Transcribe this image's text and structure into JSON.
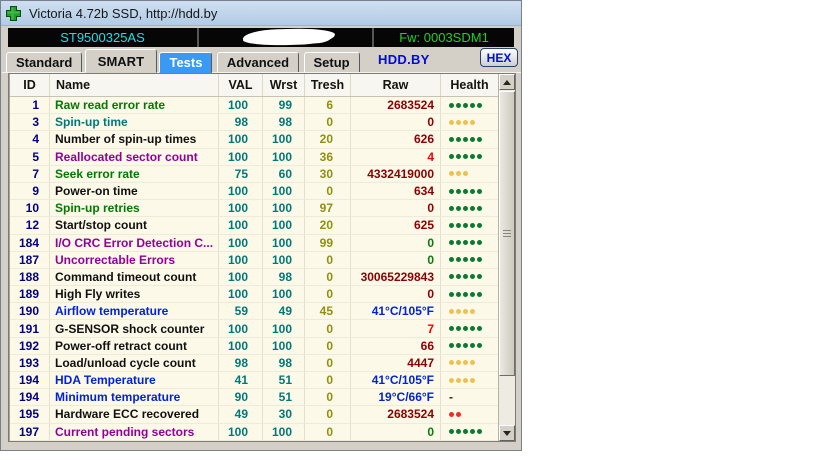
{
  "window": {
    "title": "Victoria 4.72b SSD, http://hdd.by",
    "icon": "green-cross-icon"
  },
  "drive_bar": {
    "model": "ST9500325AS",
    "serial": "(redacted)",
    "firmware": "Fw: 0003SDM1"
  },
  "tab_bar": {
    "tabs": [
      {
        "label": "Standard"
      },
      {
        "label": "SMART"
      },
      {
        "label": "Tests"
      },
      {
        "label": "Advanced"
      },
      {
        "label": "Setup"
      }
    ],
    "active_tab": "SMART",
    "highlighted_tab": "Tests",
    "brand": "HDD.BY",
    "hex_button": "HEX"
  },
  "smart_table": {
    "columns": [
      "ID",
      "Name",
      "VAL",
      "Wrst",
      "Tresh",
      "Raw",
      "Health"
    ],
    "rows": [
      {
        "id": "1",
        "name": "Raw read error rate",
        "name_color": "green",
        "val": "100",
        "wrst": "99",
        "tresh": "6",
        "raw": "2683524",
        "raw_color": "maroon",
        "health_dots": 5,
        "health_color": "green"
      },
      {
        "id": "3",
        "name": "Spin-up time",
        "name_color": "teal",
        "val": "98",
        "wrst": "98",
        "tresh": "0",
        "raw": "0",
        "raw_color": "maroon",
        "health_dots": 4,
        "health_color": "yellow"
      },
      {
        "id": "4",
        "name": "Number of spin-up times",
        "name_color": "black",
        "val": "100",
        "wrst": "100",
        "tresh": "20",
        "raw": "626",
        "raw_color": "maroon",
        "health_dots": 5,
        "health_color": "green"
      },
      {
        "id": "5",
        "name": "Reallocated sector count",
        "name_color": "purple",
        "val": "100",
        "wrst": "100",
        "tresh": "36",
        "raw": "4",
        "raw_color": "red",
        "health_dots": 5,
        "health_color": "green"
      },
      {
        "id": "7",
        "name": "Seek error rate",
        "name_color": "green",
        "val": "75",
        "wrst": "60",
        "tresh": "30",
        "raw": "4332419000",
        "raw_color": "maroon",
        "health_dots": 3,
        "health_color": "yellow"
      },
      {
        "id": "9",
        "name": "Power-on time",
        "name_color": "black",
        "val": "100",
        "wrst": "100",
        "tresh": "0",
        "raw": "634",
        "raw_color": "maroon",
        "health_dots": 5,
        "health_color": "green"
      },
      {
        "id": "10",
        "name": "Spin-up retries",
        "name_color": "green",
        "val": "100",
        "wrst": "100",
        "tresh": "97",
        "raw": "0",
        "raw_color": "maroon",
        "health_dots": 5,
        "health_color": "green"
      },
      {
        "id": "12",
        "name": "Start/stop count",
        "name_color": "black",
        "val": "100",
        "wrst": "100",
        "tresh": "20",
        "raw": "625",
        "raw_color": "maroon",
        "health_dots": 5,
        "health_color": "green"
      },
      {
        "id": "184",
        "name": "I/O CRC Error Detection C...",
        "name_color": "purple",
        "val": "100",
        "wrst": "100",
        "tresh": "99",
        "raw": "0",
        "raw_color": "green",
        "health_dots": 5,
        "health_color": "green"
      },
      {
        "id": "187",
        "name": "Uncorrectable Errors",
        "name_color": "purple",
        "val": "100",
        "wrst": "100",
        "tresh": "0",
        "raw": "0",
        "raw_color": "green",
        "health_dots": 5,
        "health_color": "green"
      },
      {
        "id": "188",
        "name": "Command timeout count",
        "name_color": "black",
        "val": "100",
        "wrst": "98",
        "tresh": "0",
        "raw": "30065229843",
        "raw_color": "maroon",
        "health_dots": 5,
        "health_color": "green"
      },
      {
        "id": "189",
        "name": "High Fly writes",
        "name_color": "black",
        "val": "100",
        "wrst": "100",
        "tresh": "0",
        "raw": "0",
        "raw_color": "maroon",
        "health_dots": 5,
        "health_color": "green"
      },
      {
        "id": "190",
        "name": "Airflow temperature",
        "name_color": "blue",
        "val": "59",
        "wrst": "49",
        "tresh": "45",
        "raw": "41°C/105°F",
        "raw_color": "blue",
        "health_dots": 4,
        "health_color": "yellow"
      },
      {
        "id": "191",
        "name": "G-SENSOR shock counter",
        "name_color": "black",
        "val": "100",
        "wrst": "100",
        "tresh": "0",
        "raw": "7",
        "raw_color": "red",
        "health_dots": 5,
        "health_color": "green"
      },
      {
        "id": "192",
        "name": "Power-off retract count",
        "name_color": "black",
        "val": "100",
        "wrst": "100",
        "tresh": "0",
        "raw": "66",
        "raw_color": "maroon",
        "health_dots": 5,
        "health_color": "green"
      },
      {
        "id": "193",
        "name": "Load/unload cycle count",
        "name_color": "black",
        "val": "98",
        "wrst": "98",
        "tresh": "0",
        "raw": "4447",
        "raw_color": "maroon",
        "health_dots": 4,
        "health_color": "yellow"
      },
      {
        "id": "194",
        "name": "HDA Temperature",
        "name_color": "blue",
        "val": "41",
        "wrst": "51",
        "tresh": "0",
        "raw": "41°C/105°F",
        "raw_color": "blue",
        "health_dots": 4,
        "health_color": "yellow"
      },
      {
        "id": "194",
        "name": "Minimum temperature",
        "name_color": "blue",
        "val": "90",
        "wrst": "51",
        "tresh": "0",
        "raw": "19°C/66°F",
        "raw_color": "blue",
        "health_dots": 0,
        "health_color": "dash"
      },
      {
        "id": "195",
        "name": "Hardware ECC recovered",
        "name_color": "black",
        "val": "49",
        "wrst": "30",
        "tresh": "0",
        "raw": "2683524",
        "raw_color": "maroon",
        "health_dots": 2,
        "health_color": "red"
      },
      {
        "id": "197",
        "name": "Current pending sectors",
        "name_color": "purple",
        "val": "100",
        "wrst": "100",
        "tresh": "0",
        "raw": "0",
        "raw_color": "green",
        "health_dots": 5,
        "health_color": "green"
      }
    ]
  },
  "colors": {
    "health_green": "#0a7a32",
    "health_yellow": "#eec14e",
    "health_red": "#f22a22",
    "titlebar_blue": "#b9cee6",
    "table_bg": "#fcf9e9",
    "highlight_tab_blue": "#3a99f2"
  }
}
